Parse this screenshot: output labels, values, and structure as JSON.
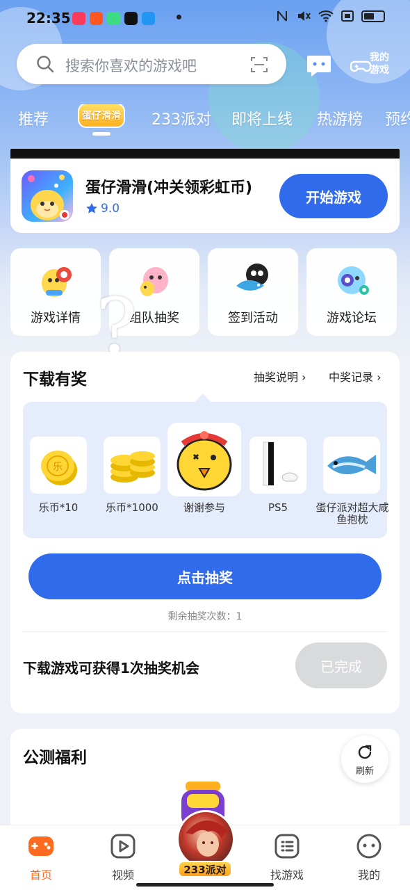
{
  "status_bar": {
    "time": "22:35",
    "app_colors": [
      "#ff3b5c",
      "#ff5722",
      "#3ddc84",
      "#111111",
      "#2196f3"
    ]
  },
  "search": {
    "placeholder": "搜索你喜欢的游戏吧",
    "my_games_label": "我的游戏"
  },
  "tabs": [
    {
      "label": "推荐"
    },
    {
      "label": "蛋仔滑滑",
      "is_logo": true,
      "selected": true
    },
    {
      "label": "233派对"
    },
    {
      "label": "即将上线"
    },
    {
      "label": "热游榜"
    },
    {
      "label": "预约"
    }
  ],
  "game": {
    "title": "蛋仔滑滑(冲关领彩虹币)",
    "rating": "9.0",
    "start_label": "开始游戏"
  },
  "quick_actions": [
    {
      "label": "游戏详情",
      "icon": "egg-character-icon"
    },
    {
      "label": "组队抽奖",
      "icon": "egg-character-pink-icon"
    },
    {
      "label": "签到活动",
      "icon": "egg-character-fish-icon"
    },
    {
      "label": "游戏论坛",
      "icon": "egg-character-blue-icon"
    }
  ],
  "reward": {
    "title": "下载有奖",
    "rules_label": "抽奖说明",
    "records_label": "中奖记录",
    "prizes": [
      {
        "label": "乐币*10",
        "icon": "coin-icon"
      },
      {
        "label": "乐币*1000",
        "icon": "coin-stack-icon"
      },
      {
        "label": "谢谢参与",
        "icon": "smiley-egg-icon"
      },
      {
        "label": "PS5",
        "icon": "ps5-console-icon"
      },
      {
        "label": "蛋仔派对超大咸鱼抱枕",
        "icon": "fish-pillow-icon"
      }
    ],
    "draw_label": "点击抽奖",
    "remaining_label": "剩余抽奖次数：1",
    "task_label": "下载游戏可获得1次抽奖机会",
    "done_label": "已完成"
  },
  "public_test": {
    "title": "公测福利",
    "refresh_label": "刷新"
  },
  "bottom_nav": [
    {
      "label": "首页",
      "icon": "gamepad-icon",
      "active": true
    },
    {
      "label": "视频",
      "icon": "video-play-icon"
    },
    {
      "label": "233派对",
      "icon": "party-avatar-icon"
    },
    {
      "label": "找游戏",
      "icon": "list-icon"
    },
    {
      "label": "我的",
      "icon": "profile-face-icon"
    }
  ],
  "colors": {
    "primary": "#2f6bea",
    "active_nav": "#ff6b1e",
    "disabled": "#d9dadc"
  }
}
